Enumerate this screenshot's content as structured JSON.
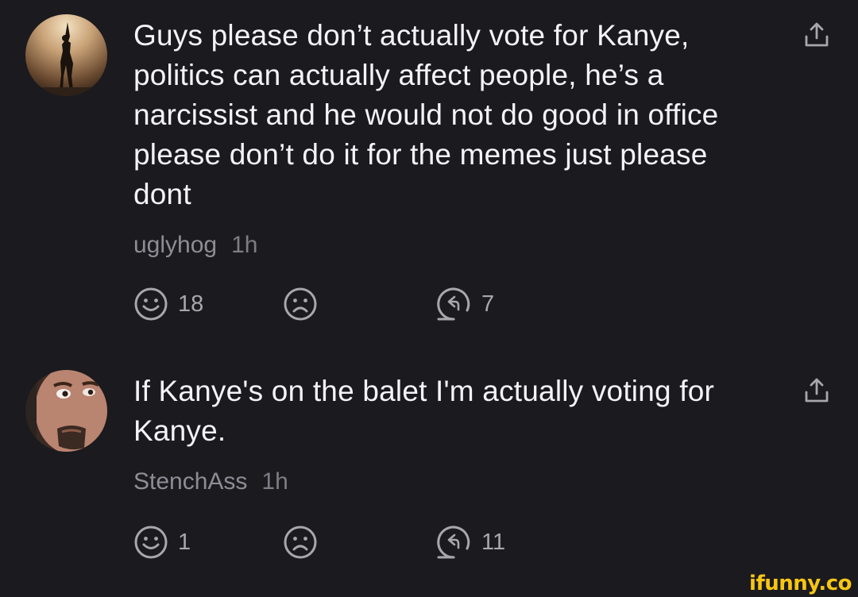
{
  "comments": [
    {
      "text": "Guys please don’t actually vote for Kanye, politics can actually affect people, he’s a narcissist and he would not do good in office please don’t do it for the memes just please dont",
      "username": "uglyhog",
      "time": "1h",
      "smile_count": "18",
      "frown_count": "",
      "reply_count": "7"
    },
    {
      "text": "If Kanye's on the balet I'm actually voting for Kanye.",
      "username": "StenchAss",
      "time": "1h",
      "smile_count": "1",
      "frown_count": "",
      "reply_count": "11"
    }
  ],
  "icons": {
    "smile": "smile-icon",
    "frown": "frown-icon",
    "reply": "reply-icon",
    "share": "share-icon"
  },
  "watermark": "ifunny.co",
  "colors": {
    "background": "#1b1a1f",
    "text": "#f4f4f6",
    "meta": "#8e8d95",
    "icon": "#a8a7ae",
    "watermark": "#f6c612"
  }
}
